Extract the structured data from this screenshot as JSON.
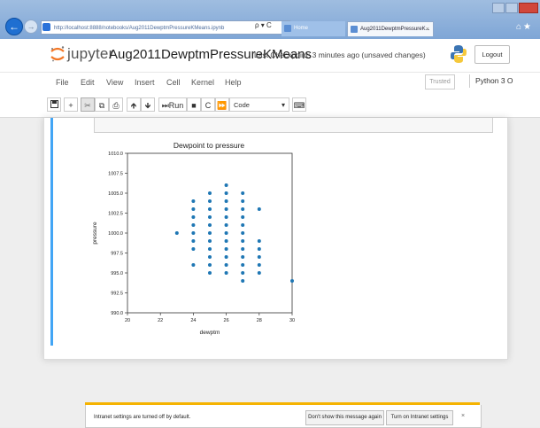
{
  "browser": {
    "address": "http://localhost:8888/notebooks/Aug2011DewptmPressureKMeans.ipynb",
    "address_tools": "ρ ▾ C",
    "tabs": [
      {
        "label": "Home",
        "active": false
      },
      {
        "label": "Aug2011DewptmPressureK...",
        "active": true
      }
    ],
    "tab_close": "×",
    "accent": "#1f6fd1"
  },
  "jupyter": {
    "brand": "jupyter",
    "notebook_name": "Aug2011DewptmPressureKMeans",
    "checkpoint": "Last Checkpoint: 3 minutes ago  (unsaved changes)",
    "logout_label": "Logout",
    "trusted_label": "Trusted",
    "kernel_label": "Python 3 O"
  },
  "menu": [
    "File",
    "Edit",
    "View",
    "Insert",
    "Cell",
    "Kernel",
    "Help"
  ],
  "toolbar": {
    "save_icon": "save-icon",
    "run_label": "Run",
    "cell_type": "Code",
    "cell_type_caret": "▾"
  },
  "chart_data": {
    "type": "scatter",
    "title": "Dewpoint to pressure",
    "xlabel": "dewptm",
    "ylabel": "pressure",
    "xlim": [
      20,
      30
    ],
    "ylim": [
      990,
      1010
    ],
    "xticks": [
      "20",
      "22",
      "24",
      "26",
      "28",
      "30"
    ],
    "yticks": [
      "990.0",
      "992.5",
      "995.0",
      "997.5",
      "1000.0",
      "1002.5",
      "1005.0",
      "1007.5",
      "1010.0"
    ],
    "marker_color": "#1f77b4",
    "points": [
      {
        "x": 23,
        "y": 1000
      },
      {
        "x": 24,
        "y": 996
      },
      {
        "x": 24,
        "y": 998
      },
      {
        "x": 24,
        "y": 999
      },
      {
        "x": 24,
        "y": 1000
      },
      {
        "x": 24,
        "y": 1001
      },
      {
        "x": 24,
        "y": 1002
      },
      {
        "x": 24,
        "y": 1003
      },
      {
        "x": 24,
        "y": 1004
      },
      {
        "x": 25,
        "y": 995
      },
      {
        "x": 25,
        "y": 996
      },
      {
        "x": 25,
        "y": 997
      },
      {
        "x": 25,
        "y": 998
      },
      {
        "x": 25,
        "y": 999
      },
      {
        "x": 25,
        "y": 1000
      },
      {
        "x": 25,
        "y": 1001
      },
      {
        "x": 25,
        "y": 1002
      },
      {
        "x": 25,
        "y": 1003
      },
      {
        "x": 25,
        "y": 1004
      },
      {
        "x": 25,
        "y": 1005
      },
      {
        "x": 26,
        "y": 995
      },
      {
        "x": 26,
        "y": 996
      },
      {
        "x": 26,
        "y": 997
      },
      {
        "x": 26,
        "y": 998
      },
      {
        "x": 26,
        "y": 999
      },
      {
        "x": 26,
        "y": 1000
      },
      {
        "x": 26,
        "y": 1001
      },
      {
        "x": 26,
        "y": 1002
      },
      {
        "x": 26,
        "y": 1003
      },
      {
        "x": 26,
        "y": 1004
      },
      {
        "x": 26,
        "y": 1005
      },
      {
        "x": 26,
        "y": 1006
      },
      {
        "x": 27,
        "y": 994
      },
      {
        "x": 27,
        "y": 995
      },
      {
        "x": 27,
        "y": 996
      },
      {
        "x": 27,
        "y": 997
      },
      {
        "x": 27,
        "y": 998
      },
      {
        "x": 27,
        "y": 999
      },
      {
        "x": 27,
        "y": 1000
      },
      {
        "x": 27,
        "y": 1001
      },
      {
        "x": 27,
        "y": 1002
      },
      {
        "x": 27,
        "y": 1003
      },
      {
        "x": 27,
        "y": 1004
      },
      {
        "x": 27,
        "y": 1005
      },
      {
        "x": 28,
        "y": 995
      },
      {
        "x": 28,
        "y": 996
      },
      {
        "x": 28,
        "y": 997
      },
      {
        "x": 28,
        "y": 998
      },
      {
        "x": 28,
        "y": 999
      },
      {
        "x": 28,
        "y": 1003
      },
      {
        "x": 30,
        "y": 994
      }
    ]
  },
  "notification": {
    "message": "Intranet settings are turned off by default.",
    "dismiss_label": "Don't show this message again",
    "enable_label": "Turn on Intranet settings",
    "close_label": "×",
    "accent": "#f5b301"
  }
}
